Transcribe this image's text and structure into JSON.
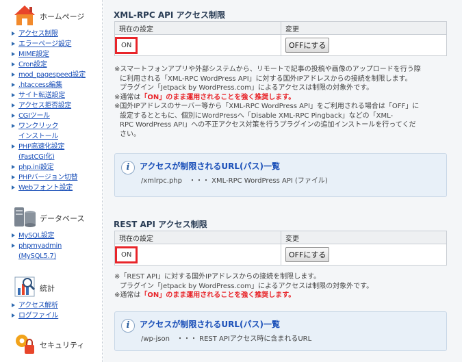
{
  "sidebar": {
    "home": {
      "title": "ホームページ",
      "items": [
        {
          "label": "アクセス制限"
        },
        {
          "label": "エラーページ設定"
        },
        {
          "label": "MIME設定"
        },
        {
          "label": "Cron設定"
        },
        {
          "label": "mod_pagespeed設定"
        },
        {
          "label": ".htaccess編集"
        },
        {
          "label": "サイト転送設定"
        },
        {
          "label": "アクセス拒否設定"
        },
        {
          "label": "CGIツール"
        },
        {
          "label": "ワンクリック",
          "label2": "インストール"
        },
        {
          "label": "PHP高速化設定",
          "label2": "(FastCGI化)"
        },
        {
          "label": "php.ini設定"
        },
        {
          "label": "PHPバージョン切替"
        },
        {
          "label": "Webフォント設定"
        }
      ]
    },
    "database": {
      "title": "データベース",
      "items": [
        {
          "label": "MySQL設定"
        },
        {
          "label": "phpmyadmin",
          "label2": "(MySQL5.7)"
        }
      ]
    },
    "stats": {
      "title": "統計",
      "items": [
        {
          "label": "アクセス解析"
        },
        {
          "label": "ログファイル"
        }
      ]
    },
    "security": {
      "title": "セキュリティ"
    }
  },
  "xmlrpc": {
    "title": "XML-RPC API アクセス制限",
    "col_current": "現在の設定",
    "col_change": "変更",
    "current_value": "ON",
    "button_label": "OFFにする",
    "notes": {
      "n1a": "※スマートフォンアプリや外部システムから、リモートで記事の投稿や画像のアップロードを行う際",
      "n1b": "に利用される「XML-RPC WordPress API」に対する国外IPアドレスからの接続を制限します。",
      "n1c": "プラグイン「Jetpack by WordPress.com」によるアクセスは制限の対象外です。",
      "n2_prefix": "※通常は",
      "n2_red": "「ON」のまま運用されることを強く推奨します。",
      "n3a": "※国外IPアドレスのサーバー等から「XML-RPC WordPress API」をご利用される場合は「OFF」に",
      "n3b": "設定するとともに、個別にWordPressへ「Disable XML-RPC Pingback」などの「XML-",
      "n3c": "RPC WordPress API」への不正アクセス対策を行うプラグインの追加インストールを行ってくだ",
      "n3d": "さい。"
    },
    "info": {
      "title": "アクセスが制限されるURL(パス)一覧",
      "text": "/xmlrpc.php　・・・ XML-RPC WordPress API (ファイル)"
    }
  },
  "rest": {
    "title": "REST API アクセス制限",
    "col_current": "現在の設定",
    "col_change": "変更",
    "current_value": "ON",
    "button_label": "OFFにする",
    "notes": {
      "n1a": "※「REST API」に対する国外IPアドレスからの接続を制限します。",
      "n1b": "プラグイン「Jetpack by WordPress.com」によるアクセスは制限の対象外です。",
      "n2_prefix": "※通常は",
      "n2_red": "「ON」のまま運用されることを強く推奨します。"
    },
    "info": {
      "title": "アクセスが制限されるURL(パス)一覧",
      "text": "/wp-json　・・・ REST APIアクセス時に含まれるURL"
    }
  },
  "colors": {
    "accent_red": "#e8252a",
    "link_blue": "#1a4fb8",
    "info_bg": "#e8f0f8"
  }
}
